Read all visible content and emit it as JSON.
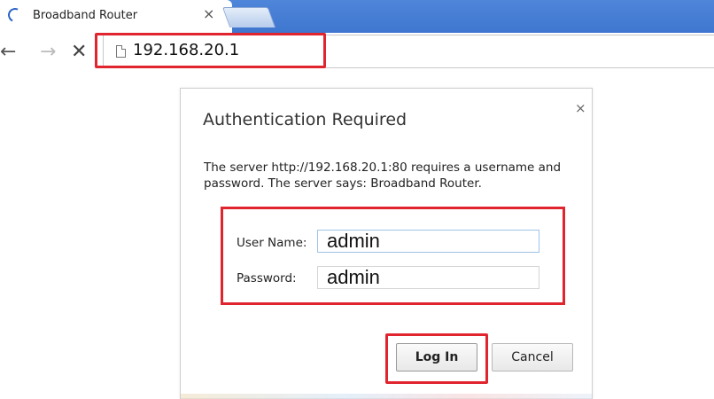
{
  "browser": {
    "tab": {
      "title": "Broadband Router",
      "close_glyph": "×",
      "loading_icon": "spinner-icon"
    },
    "new_tab_icon": "new-tab-icon",
    "nav": {
      "back": "←",
      "forward": "→",
      "stop": "✕"
    },
    "address": {
      "url": "192.168.20.1",
      "icon": "page-icon"
    }
  },
  "dialog": {
    "title": "Authentication Required",
    "close_glyph": "×",
    "message": "The server http://192.168.20.1:80 requires a username and password. The server says: Broadband Router.",
    "fields": {
      "username": {
        "label": "User Name:",
        "value": "admin"
      },
      "password": {
        "label": "Password:",
        "value": "admin"
      }
    },
    "buttons": {
      "login": "Log In",
      "cancel": "Cancel"
    }
  },
  "highlight_color": "#e0252f",
  "accent": "#4a80d6"
}
